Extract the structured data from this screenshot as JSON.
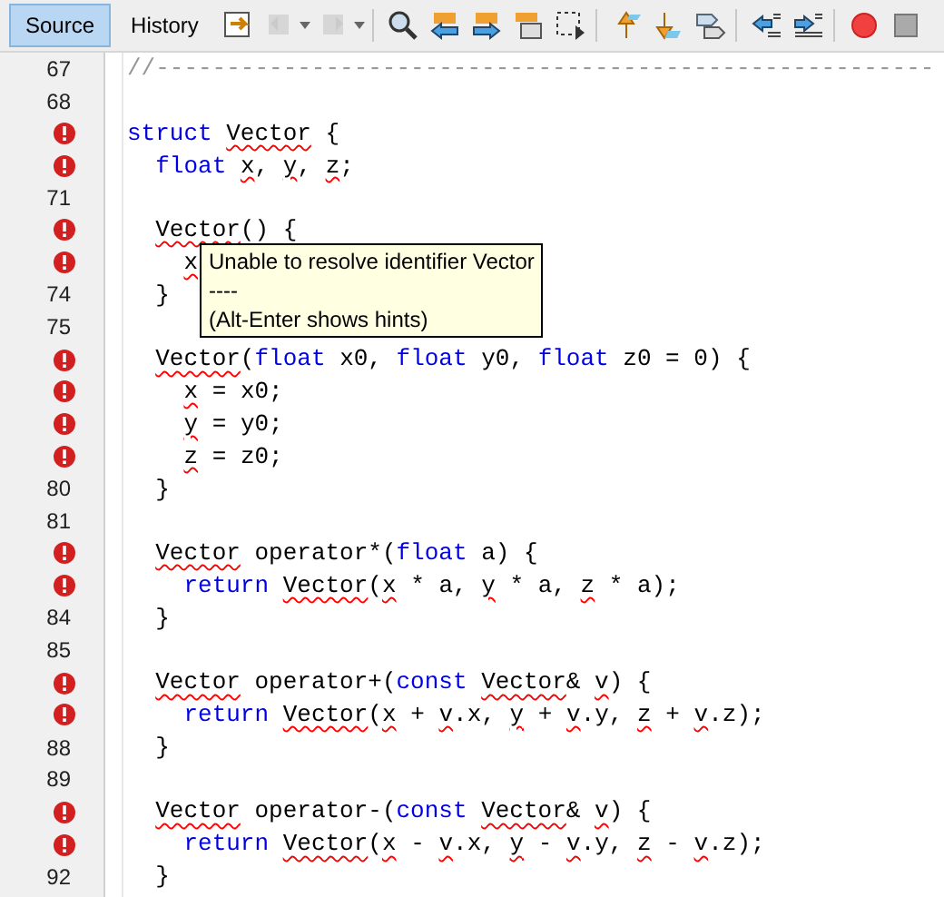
{
  "tabs": [
    {
      "label": "Source",
      "selected": true
    },
    {
      "label": "History",
      "selected": false
    }
  ],
  "toolbar_buttons": [
    {
      "disabled": false
    },
    {
      "disabled": true
    },
    {
      "disabled": true
    },
    {
      "disabled": false
    },
    {
      "disabled": false
    },
    {
      "disabled": false
    },
    {
      "disabled": false
    },
    {
      "disabled": false
    },
    {
      "disabled": false
    },
    {
      "disabled": false
    },
    {
      "disabled": false
    },
    {
      "disabled": false
    },
    {
      "disabled": false
    },
    {
      "disabled": false
    },
    {
      "disabled": false
    }
  ],
  "lines": [
    {
      "number": "67",
      "error": false,
      "segments": [
        {
          "text": "//-------------------------------------------------------",
          "kind": "comment"
        }
      ]
    },
    {
      "number": "68",
      "error": false
    },
    {
      "error": true,
      "segments": [
        {
          "text": "struct",
          "kind": "keyword"
        },
        {
          "text": " Vector",
          "kind": "unresolved"
        },
        {
          "text": " {",
          "kind": "plain"
        }
      ]
    },
    {
      "error": true,
      "segments": [
        {
          "text": "  float",
          "kind": "keyword"
        },
        {
          "text": " x",
          "kind": "unresolved"
        },
        {
          "text": ",",
          "kind": "plain"
        },
        {
          "text": " y",
          "kind": "unresolved"
        },
        {
          "text": ",",
          "kind": "plain"
        },
        {
          "text": " z",
          "kind": "unresolved"
        },
        {
          "text": ";",
          "kind": "plain"
        }
      ]
    },
    {
      "number": "71",
      "error": false
    },
    {
      "error": true,
      "segments": [
        {
          "text": "  Vector",
          "kind": "unresolved"
        },
        {
          "text": "() {",
          "kind": "plain"
        }
      ]
    },
    {
      "error": true,
      "segments": [
        {
          "text": "    x",
          "kind": "unresolved"
        }
      ]
    },
    {
      "number": "74",
      "error": false,
      "segments": [
        {
          "text": "  }",
          "kind": "plain"
        }
      ]
    },
    {
      "number": "75",
      "error": false
    },
    {
      "error": true,
      "segments": [
        {
          "text": "  Vector",
          "kind": "unresolved"
        },
        {
          "text": "(",
          "kind": "plain"
        },
        {
          "text": "float",
          "kind": "keyword"
        },
        {
          "text": " x0, ",
          "kind": "plain"
        },
        {
          "text": "float",
          "kind": "keyword"
        },
        {
          "text": " y0, ",
          "kind": "plain"
        },
        {
          "text": "float",
          "kind": "keyword"
        },
        {
          "text": " z0 = 0) {",
          "kind": "plain"
        }
      ]
    },
    {
      "error": true,
      "segments": [
        {
          "text": "    x",
          "kind": "unresolved"
        },
        {
          "text": " = x0;",
          "kind": "plain"
        }
      ]
    },
    {
      "error": true,
      "segments": [
        {
          "text": "    y",
          "kind": "unresolved"
        },
        {
          "text": " = y0;",
          "kind": "plain"
        }
      ]
    },
    {
      "error": true,
      "segments": [
        {
          "text": "    z",
          "kind": "unresolved"
        },
        {
          "text": " = z0;",
          "kind": "plain"
        }
      ]
    },
    {
      "number": "80",
      "error": false,
      "segments": [
        {
          "text": "  }",
          "kind": "plain"
        }
      ]
    },
    {
      "number": "81",
      "error": false
    },
    {
      "error": true,
      "segments": [
        {
          "text": "  Vector",
          "kind": "unresolved"
        },
        {
          "text": " operator*(",
          "kind": "plain"
        },
        {
          "text": "float",
          "kind": "keyword"
        },
        {
          "text": " a) {",
          "kind": "plain"
        }
      ]
    },
    {
      "error": true,
      "segments": [
        {
          "text": "    return",
          "kind": "keyword"
        },
        {
          "text": " Vector",
          "kind": "unresolved"
        },
        {
          "text": "(",
          "kind": "plain"
        },
        {
          "text": "x",
          "kind": "unresolved"
        },
        {
          "text": " * a,",
          "kind": "plain"
        },
        {
          "text": " y",
          "kind": "unresolved"
        },
        {
          "text": " * a,",
          "kind": "plain"
        },
        {
          "text": " z",
          "kind": "unresolved"
        },
        {
          "text": " * a);",
          "kind": "plain"
        }
      ]
    },
    {
      "number": "84",
      "error": false,
      "segments": [
        {
          "text": "  }",
          "kind": "plain"
        }
      ]
    },
    {
      "number": "85",
      "error": false
    },
    {
      "error": true,
      "segments": [
        {
          "text": "  Vector",
          "kind": "unresolved"
        },
        {
          "text": " operator+(",
          "kind": "plain"
        },
        {
          "text": "const",
          "kind": "keyword"
        },
        {
          "text": " Vector",
          "kind": "unresolved"
        },
        {
          "text": "&",
          "kind": "plain"
        },
        {
          "text": " v",
          "kind": "unresolved"
        },
        {
          "text": ") {",
          "kind": "plain"
        }
      ]
    },
    {
      "error": true,
      "segments": [
        {
          "text": "    return",
          "kind": "keyword"
        },
        {
          "text": " Vector",
          "kind": "unresolved"
        },
        {
          "text": "(",
          "kind": "plain"
        },
        {
          "text": "x",
          "kind": "unresolved"
        },
        {
          "text": " +",
          "kind": "plain"
        },
        {
          "text": " v",
          "kind": "unresolved"
        },
        {
          "text": ".x,",
          "kind": "plain"
        },
        {
          "text": " y",
          "kind": "unresolved"
        },
        {
          "text": " +",
          "kind": "plain"
        },
        {
          "text": " v",
          "kind": "unresolved"
        },
        {
          "text": ".y,",
          "kind": "plain"
        },
        {
          "text": " z",
          "kind": "unresolved"
        },
        {
          "text": " +",
          "kind": "plain"
        },
        {
          "text": " v",
          "kind": "unresolved"
        },
        {
          "text": ".z);",
          "kind": "plain"
        }
      ]
    },
    {
      "number": "88",
      "error": false,
      "segments": [
        {
          "text": "  }",
          "kind": "plain"
        }
      ]
    },
    {
      "number": "89",
      "error": false
    },
    {
      "error": true,
      "segments": [
        {
          "text": "  Vector",
          "kind": "unresolved"
        },
        {
          "text": " operator-(",
          "kind": "plain"
        },
        {
          "text": "const",
          "kind": "keyword"
        },
        {
          "text": " Vector",
          "kind": "unresolved"
        },
        {
          "text": "&",
          "kind": "plain"
        },
        {
          "text": " v",
          "kind": "unresolved"
        },
        {
          "text": ") {",
          "kind": "plain"
        }
      ]
    },
    {
      "error": true,
      "segments": [
        {
          "text": "    return",
          "kind": "keyword"
        },
        {
          "text": " Vector",
          "kind": "unresolved"
        },
        {
          "text": "(",
          "kind": "plain"
        },
        {
          "text": "x",
          "kind": "unresolved"
        },
        {
          "text": " -",
          "kind": "plain"
        },
        {
          "text": " v",
          "kind": "unresolved"
        },
        {
          "text": ".x,",
          "kind": "plain"
        },
        {
          "text": " y",
          "kind": "unresolved"
        },
        {
          "text": " -",
          "kind": "plain"
        },
        {
          "text": " v",
          "kind": "unresolved"
        },
        {
          "text": ".y,",
          "kind": "plain"
        },
        {
          "text": " z",
          "kind": "unresolved"
        },
        {
          "text": " -",
          "kind": "plain"
        },
        {
          "text": " v",
          "kind": "unresolved"
        },
        {
          "text": ".z);",
          "kind": "plain"
        }
      ]
    },
    {
      "number": "92",
      "error": false,
      "segments": [
        {
          "text": "  }",
          "kind": "plain"
        }
      ]
    }
  ],
  "tooltip": {
    "lines": [
      "Unable to resolve identifier Vector",
      "----",
      "(Alt-Enter shows hints)"
    ]
  }
}
